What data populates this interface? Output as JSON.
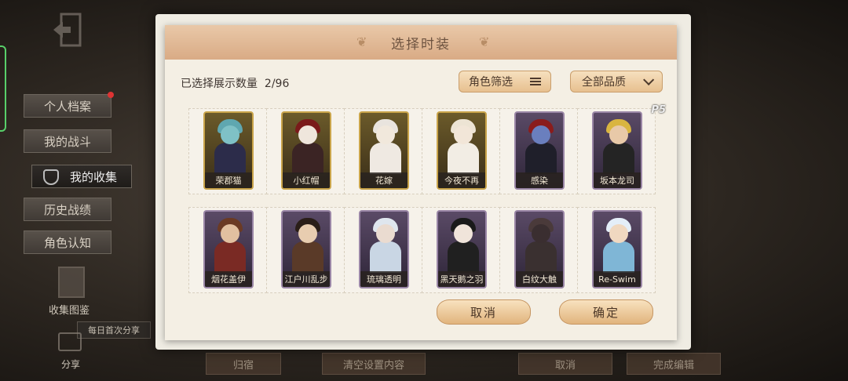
{
  "background": {
    "sidebar": [
      {
        "label": "个人档案"
      },
      {
        "label": "我的战斗"
      },
      {
        "label": "我的收集"
      },
      {
        "label": "历史战绩"
      },
      {
        "label": "角色认知"
      }
    ],
    "album_label": "收集图鉴",
    "share_tip": "每日首次分享",
    "share_label": "分享",
    "bottom_buttons": [
      "归宿",
      "清空设置内容",
      "取消",
      "完成编辑"
    ]
  },
  "modal": {
    "title": "选择时装",
    "count_label": "已选择展示数量",
    "count_value": "2/96",
    "filter_role": "角色筛选",
    "filter_quality": "全部品质",
    "cancel": "取消",
    "confirm": "确定"
  },
  "cards": [
    {
      "label": "荣郡猫",
      "frame": "#c9a44a",
      "bg1": "#6b5a2a",
      "bg2": "#3a2e18",
      "skin": "#7fc1c6",
      "hair": "#5fa7b0",
      "cloth": "#2c2c4a"
    },
    {
      "label": "小红帽",
      "frame": "#c9a44a",
      "bg1": "#6b5a2a",
      "bg2": "#3a2e18",
      "skin": "#efe6dc",
      "hair": "#7a1a1a",
      "cloth": "#3b2424"
    },
    {
      "label": "花嫁",
      "frame": "#c9a44a",
      "bg1": "#6b5a2a",
      "bg2": "#3a2e18",
      "skin": "#f1e8dc",
      "hair": "#e9e4de",
      "cloth": "#efe9e2"
    },
    {
      "label": "今夜不再",
      "frame": "#c9a44a",
      "bg1": "#6b5a2a",
      "bg2": "#3a2e18",
      "skin": "#f2e6d8",
      "hair": "#ede4d4",
      "cloth": "#f2ede4"
    },
    {
      "label": "感染",
      "frame": "#9a86a6",
      "bg1": "#5a4a66",
      "bg2": "#2e2538",
      "skin": "#6a7fbe",
      "hair": "#8a1c1c",
      "cloth": "#1f1f2a"
    },
    {
      "label": "坂本龙司",
      "frame": "#9a86a6",
      "bg1": "#5a4a66",
      "bg2": "#2e2538",
      "skin": "#e8c9a8",
      "hair": "#d9b540",
      "cloth": "#242424"
    },
    {
      "label": "烟花盖伊",
      "frame": "#9a86a6",
      "bg1": "#5a4a66",
      "bg2": "#2e2538",
      "skin": "#e2c0a0",
      "hair": "#6b3a24",
      "cloth": "#7a2a24"
    },
    {
      "label": "江户川乱步",
      "frame": "#9a86a6",
      "bg1": "#5a4a66",
      "bg2": "#2e2538",
      "skin": "#e8cdb0",
      "hair": "#2a1e18",
      "cloth": "#5a3a28"
    },
    {
      "label": "琉璃透明",
      "frame": "#9a86a6",
      "bg1": "#5a4a66",
      "bg2": "#2e2538",
      "skin": "#eadbd0",
      "hair": "#dfe6ee",
      "cloth": "#c9d6e4"
    },
    {
      "label": "黑天鹅之羽",
      "frame": "#9a86a6",
      "bg1": "#5a4a66",
      "bg2": "#2e2538",
      "skin": "#f0e4da",
      "hair": "#1a1a1a",
      "cloth": "#202020"
    },
    {
      "label": "白纹大触",
      "frame": "#9a86a6",
      "bg1": "#5a4a66",
      "bg2": "#2e2538",
      "skin": "#3a2e30",
      "hair": "#4a3a3a",
      "cloth": "#3a3030"
    },
    {
      "label": "Re-Swim",
      "frame": "#9a86a6",
      "bg1": "#5a4a66",
      "bg2": "#2e2538",
      "skin": "#f0d8c0",
      "hair": "#e4eef8",
      "cloth": "#7fb6d6"
    }
  ],
  "badge_p5": "P5"
}
